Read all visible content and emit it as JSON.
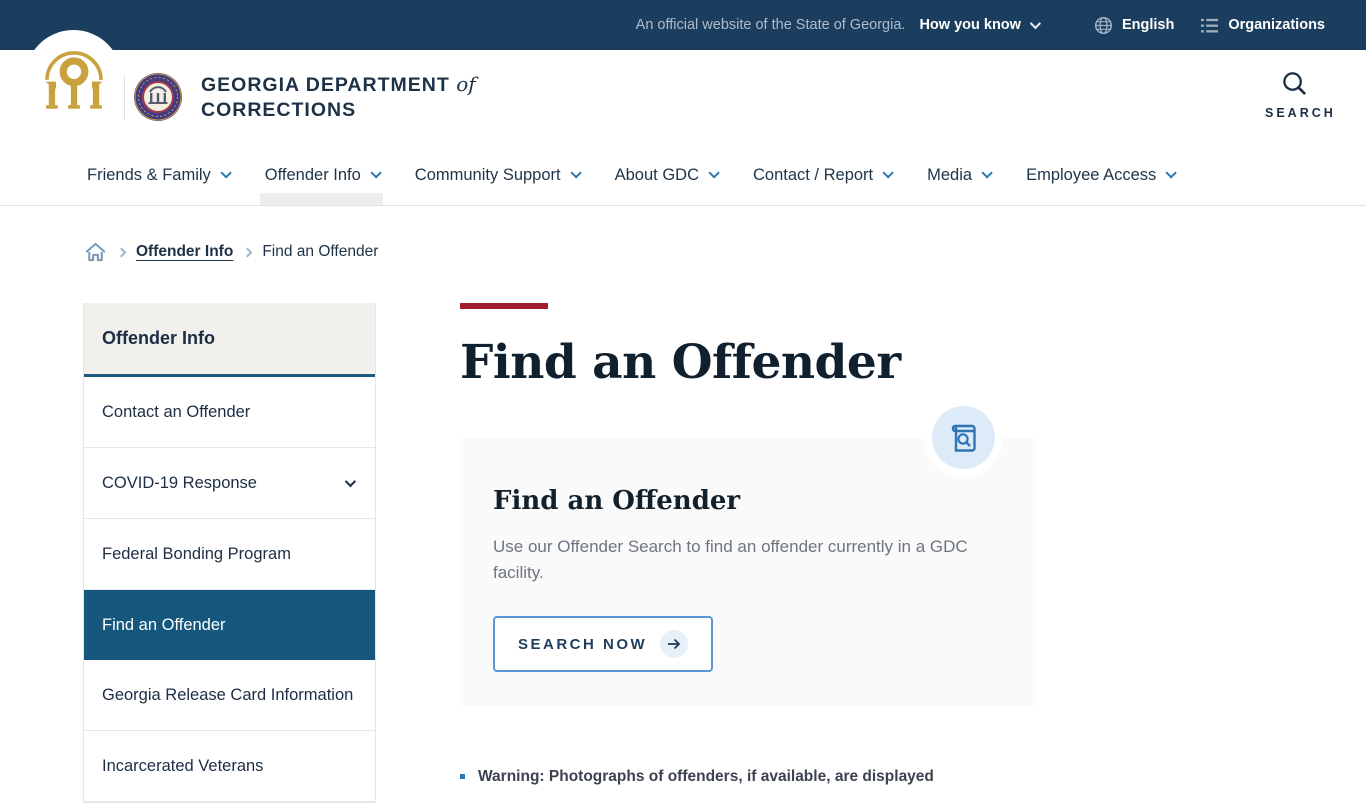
{
  "topbar": {
    "official_text": "An official website of the State of Georgia.",
    "how_you_know": "How you know",
    "language": "English",
    "organizations": "Organizations"
  },
  "header": {
    "agency_line1": "GEORGIA DEPARTMENT",
    "agency_of": "of",
    "agency_line2": "CORRECTIONS",
    "search_label": "SEARCH"
  },
  "nav": {
    "items": [
      {
        "label": "Friends & Family",
        "active": false
      },
      {
        "label": "Offender Info",
        "active": true
      },
      {
        "label": "Community Support",
        "active": false
      },
      {
        "label": "About GDC",
        "active": false
      },
      {
        "label": "Contact / Report",
        "active": false
      },
      {
        "label": "Media",
        "active": false
      },
      {
        "label": "Employee Access",
        "active": false
      }
    ]
  },
  "breadcrumb": {
    "link": "Offender Info",
    "current": "Find an Offender"
  },
  "sidebar": {
    "title": "Offender Info",
    "items": [
      {
        "label": "Contact an Offender",
        "active": false,
        "expandable": false
      },
      {
        "label": "COVID-19 Response",
        "active": false,
        "expandable": true
      },
      {
        "label": "Federal Bonding Program",
        "active": false,
        "expandable": false
      },
      {
        "label": "Find an Offender",
        "active": true,
        "expandable": false
      },
      {
        "label": "Georgia Release Card Information",
        "active": false,
        "expandable": false
      },
      {
        "label": "Incarcerated Veterans",
        "active": false,
        "expandable": false
      }
    ]
  },
  "main": {
    "page_title": "Find an Offender",
    "card": {
      "title": "Find an Offender",
      "description": "Use our Offender Search to find an offender currently in a GDC facility.",
      "button_label": "SEARCH NOW"
    },
    "warning": "Warning: Photographs of offenders, if available, are displayed"
  },
  "icons": [
    "globe-icon",
    "org-list-icon",
    "chevron-down-icon",
    "search-icon",
    "home-icon",
    "arch-logo-icon",
    "gdc-seal-icon",
    "book-search-icon",
    "arrow-right-icon"
  ],
  "colors": {
    "topbar_navy": "#1c3e5e",
    "active_blue": "#16577e",
    "accent_red": "#a41e31",
    "link_blue": "#2b77ae",
    "gold": "#c9a23f"
  }
}
